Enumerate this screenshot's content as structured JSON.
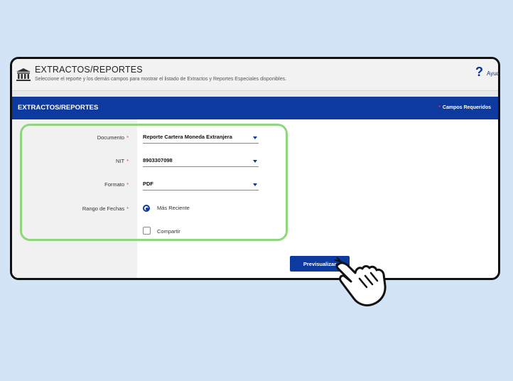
{
  "header": {
    "title": "EXTRACTOS/REPORTES",
    "subtitle": "Seleccione el reporte y los demás campos para mostrar el listado de Extractos y Reportes Especiales disponibles.",
    "help_icon": "?",
    "help_text": "Ayud"
  },
  "section_bar": {
    "title": "EXTRACTOS/REPORTES",
    "required_mark": "*",
    "required_label": "Campos Requeridos"
  },
  "form": {
    "required_mark": "*",
    "documento": {
      "label": "Documento",
      "value": "Reporte Cartera Moneda Extranjera"
    },
    "nit": {
      "label": "NIT",
      "value": "8903307098"
    },
    "formato": {
      "label": "Formato",
      "value": "PDF"
    },
    "rango": {
      "label": "Rango de Fechas",
      "option": "Más Reciente"
    },
    "compartir": {
      "label": "Compartir"
    }
  },
  "actions": {
    "preview_label": "Previsualizar"
  },
  "colors": {
    "primary": "#0d3a9e",
    "highlight": "#8fd67e",
    "required": "#e23b3b",
    "background": "#d3e4f6"
  },
  "icons": {
    "header": "bank-icon",
    "pointer": "hand-pointer-icon"
  }
}
